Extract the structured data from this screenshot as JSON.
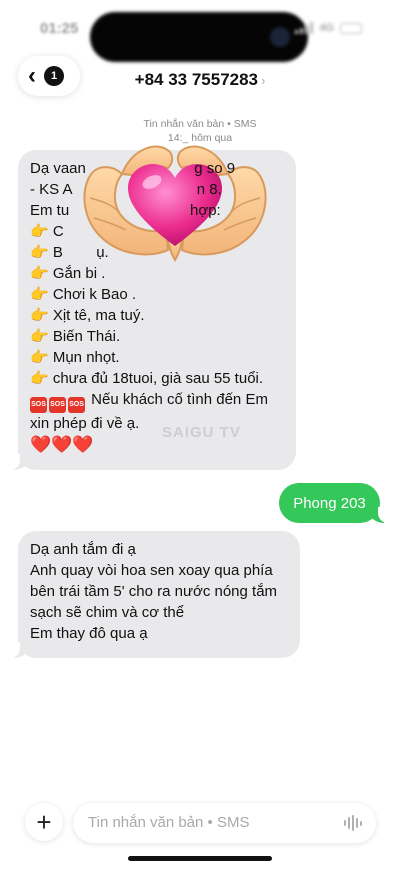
{
  "status": {
    "time": "01:25",
    "network": "4G"
  },
  "header": {
    "unread_count": "1",
    "contact": "+84 33 7557283",
    "contact_chevron": "›"
  },
  "thread": {
    "message_type": "Tin nhắn văn bản • SMS",
    "timestamp": "14:_ hôm qua"
  },
  "messages": {
    "first": {
      "lines": [
        "Dạ vaan                          g so 9",
        "- KS A                              n 8.",
        "Em tu                             hợp:",
        "👉 C",
        "👉 B        ụ.",
        "👉 Gắn bi .",
        "👉 Chơi k Bao .",
        "👉 Xịt tê, ma tuý.",
        "👉 Biến Thái.",
        "👉 Mụn nhọt.",
        "👉 chưa đủ 18tuoi, già sau 55 tuổi.",
        "Nếu khách cố tình đến Em",
        "xin phép đi về ạ.",
        "❤️❤️❤️"
      ],
      "sos_label": "SOS"
    },
    "outgoing": {
      "text": "Phong 203"
    },
    "second": {
      "lines": [
        "Dạ anh tắm đi ạ",
        "Anh quay vòi hoa sen xoay qua phía",
        "bên trái tầm 5' cho ra nước nóng tắm",
        "sạch sẽ chim và cơ thể",
        "Em thay đô qua ạ"
      ]
    }
  },
  "watermark": "SAIGU TV",
  "composer": {
    "placeholder": "Tin nhắn văn bản • SMS",
    "plus_icon": "plus-icon",
    "voice_icon": "waveform-icon"
  },
  "colors": {
    "outgoing_bubble": "#34c759",
    "incoming_bubble": "#e9e9eb",
    "sos_red": "#e4352b"
  }
}
